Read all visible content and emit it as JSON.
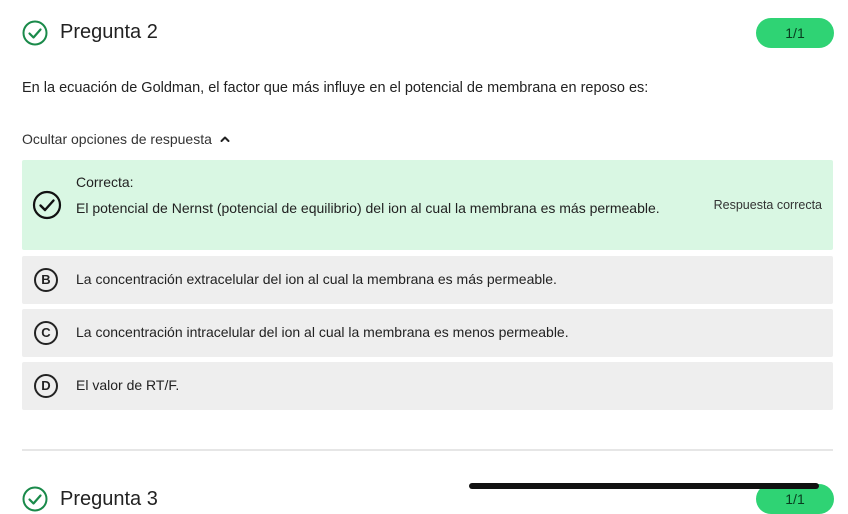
{
  "header": {
    "title": "Pregunta 2",
    "score": "1/1"
  },
  "question": {
    "text": "En la ecuación de Goldman, el factor que más influye en el potencial de membrana en reposo es:"
  },
  "toggle": {
    "label": "Ocultar opciones de respuesta"
  },
  "options": [
    {
      "status_label": "Correcta:",
      "text": "El potencial de Nernst (potencial de equilibrio) del ion al cual la membrana es más permeable.",
      "right_label": "Respuesta correcta",
      "icon": "check-circle-icon"
    },
    {
      "letter": "B",
      "text": "La concentración extracelular del ion al cual la membrana es más permeable."
    },
    {
      "letter": "C",
      "text": "La concentración intracelular del ion al cual la membrana es menos permeable."
    },
    {
      "letter": "D",
      "text": "El valor de RT/F."
    }
  ],
  "next_question": {
    "title": "Pregunta 3",
    "score": "1/1"
  },
  "colors": {
    "accent_green": "#2fd374",
    "correct_bg": "#d9f7e3",
    "option_bg": "#eeeeee",
    "check_green": "#1a8a4a"
  }
}
